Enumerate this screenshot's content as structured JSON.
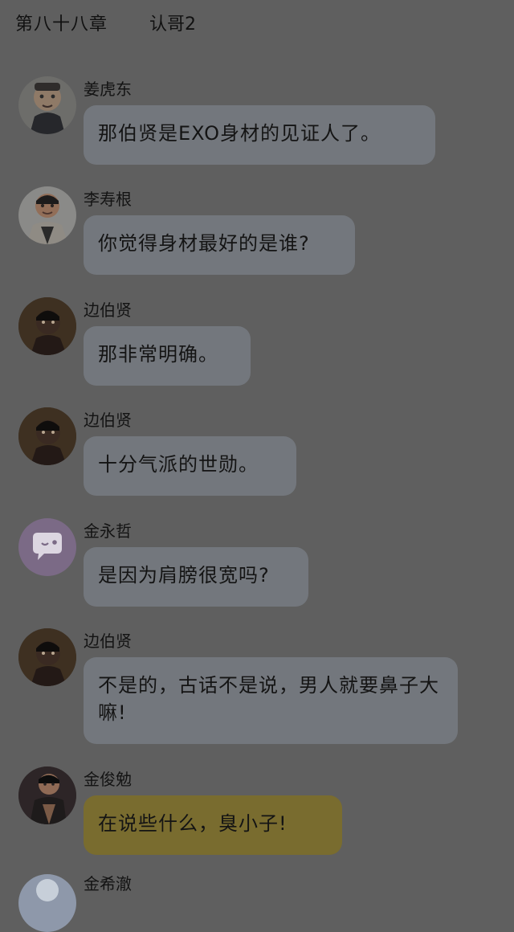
{
  "header": {
    "chapter": "第八十八章",
    "title": "认哥2"
  },
  "messages": [
    {
      "name": "姜虎东",
      "text": "那伯贤是EXO身材的见证人了。",
      "avatar": "person-avatar",
      "accent": "#73777d"
    },
    {
      "name": "李寿根",
      "text": "你觉得身材最好的是谁?",
      "avatar": "person-avatar",
      "accent": "#73777d"
    },
    {
      "name": "边伯贤",
      "text": "那非常明确。",
      "avatar": "person-avatar",
      "accent": "#73777d"
    },
    {
      "name": "边伯贤",
      "text": "十分气派的世勋。",
      "avatar": "person-avatar",
      "accent": "#73777d"
    },
    {
      "name": "金永哲",
      "text": "是因为肩膀很宽吗?",
      "avatar": "chat-bubble-avatar",
      "accent": "#73777d"
    },
    {
      "name": "边伯贤",
      "text": "不是的，古话不是说，男人就要鼻子大嘛!",
      "avatar": "person-avatar",
      "accent": "#73777d"
    },
    {
      "name": "金俊勉",
      "text": "在说些什么，臭小子!",
      "avatar": "person-avatar",
      "accent": "#796c2f"
    }
  ],
  "partial": {
    "name": "金希澈"
  }
}
